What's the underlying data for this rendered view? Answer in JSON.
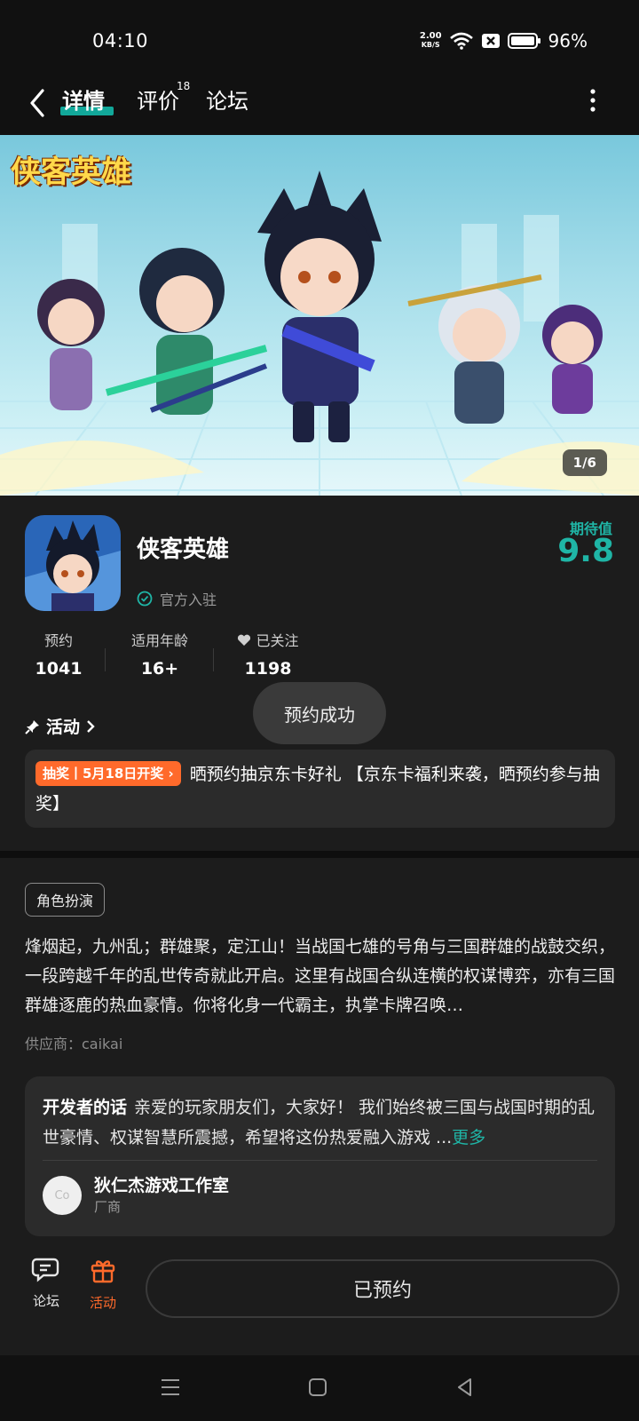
{
  "status_bar": {
    "time": "04:10",
    "net_speed_value": "2.00",
    "net_speed_unit": "KB/S",
    "battery": "96%"
  },
  "nav": {
    "tabs": [
      {
        "label": "详情"
      },
      {
        "label": "评价",
        "badge": "18"
      },
      {
        "label": "论坛"
      }
    ]
  },
  "banner": {
    "logo_text": "侠客英雄",
    "counter": "1/6"
  },
  "app": {
    "name": "侠客英雄",
    "official_label": "官方入驻",
    "expect_label": "期待值",
    "expect_value": "9.8",
    "stats": [
      {
        "label": "预约",
        "value": "1041"
      },
      {
        "label": "适用年龄",
        "value": "16+"
      },
      {
        "label": "已关注",
        "value": "1198"
      }
    ]
  },
  "activity": {
    "header": "活动",
    "tag": "抽奖丨5月18日开奖",
    "text": "晒预约抽京东卡好礼 【京东卡福利来袭，晒预约参与抽奖】"
  },
  "toast": "预约成功",
  "description": {
    "category_tag": "角色扮演",
    "text": "烽烟起，九州乱；群雄聚，定江山！当战国七雄的号角与三国群雄的战鼓交织，一段跨越千年的乱世传奇就此开启。这里有战国合纵连横的权谋博弈，亦有三国群雄逐鹿的热血豪情。你将化身一代霸主，执掌卡牌召唤…",
    "supplier": "供应商：caikai"
  },
  "developer": {
    "lead": "开发者的话",
    "text": "亲爱的玩家朋友们，大家好！ 我们始终被三国与战国时期的乱世豪情、权谋智慧所震撼，希望将这份热爱融入游戏 ...",
    "more": "更多",
    "avatar_text": "Co",
    "name": "狄仁杰游戏工作室",
    "role": "厂商"
  },
  "bottom": {
    "forum_label": "论坛",
    "activity_label": "活动",
    "reserved_label": "已预约"
  },
  "colors": {
    "accent": "#1fb5a6",
    "orange": "#ff6a2b",
    "background": "#1c1c1c"
  }
}
